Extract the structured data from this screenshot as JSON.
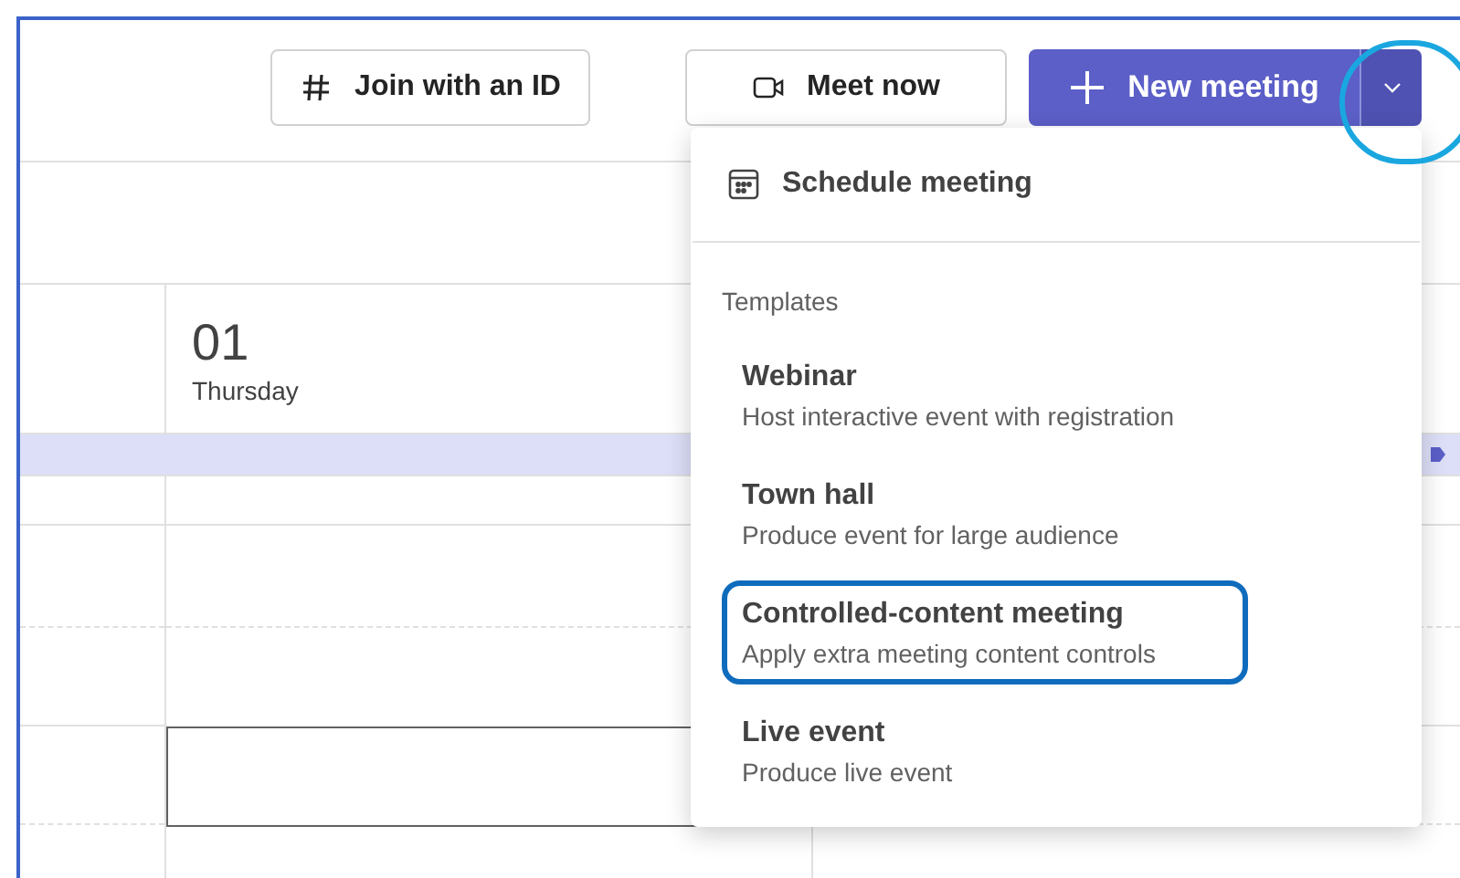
{
  "toolbar": {
    "buttons": [
      {
        "kind": "join",
        "label": "Join with an ID"
      },
      {
        "kind": "meet",
        "label": "Meet now"
      }
    ],
    "new_meeting": {
      "label": "New meeting",
      "dropdown_highlighted": true
    }
  },
  "calendar": {
    "day_number": "01",
    "day_name": "Thursday"
  },
  "menu": {
    "schedule": {
      "label": "Schedule meeting"
    },
    "section": "Templates",
    "items": [
      {
        "title": "Webinar",
        "description": "Host interactive event with registration",
        "highlighted": false
      },
      {
        "title": "Town hall",
        "description": "Produce event for large audience",
        "highlighted": false
      },
      {
        "title": "Controlled-content meeting",
        "description": "Apply extra meeting content controls",
        "highlighted": true
      },
      {
        "title": "Live event",
        "description": "Produce live event",
        "highlighted": false
      }
    ]
  }
}
